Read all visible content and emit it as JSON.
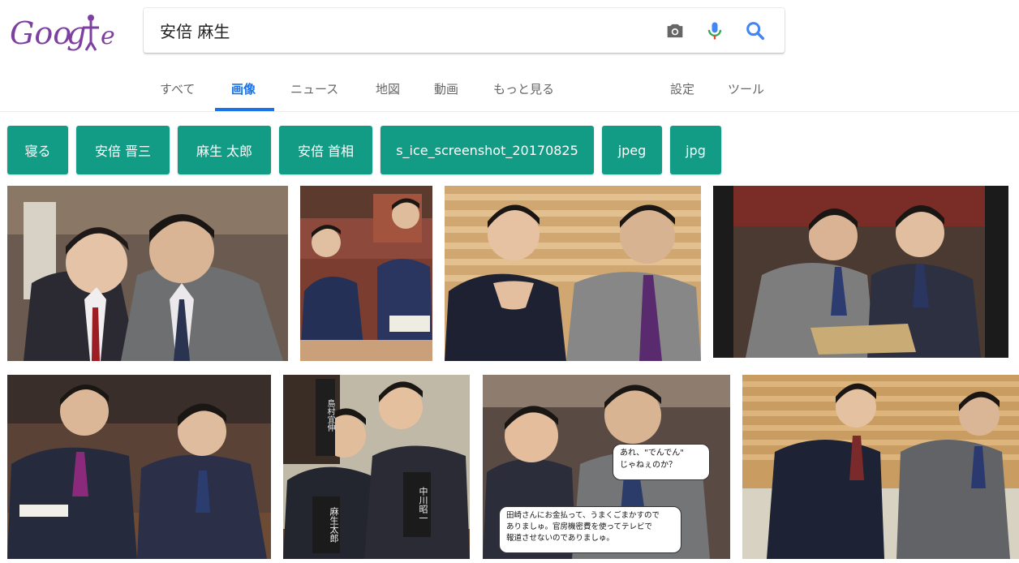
{
  "search": {
    "query": "安倍 麻生"
  },
  "tabs": [
    {
      "label": "すべて"
    },
    {
      "label": "画像"
    },
    {
      "label": "ニュース"
    },
    {
      "label": "地図"
    },
    {
      "label": "動画"
    },
    {
      "label": "もっと見る"
    },
    {
      "label": "設定"
    },
    {
      "label": "ツール"
    }
  ],
  "chips": [
    {
      "label": "寝る"
    },
    {
      "label": "安倍 晋三"
    },
    {
      "label": "麻生 太郎"
    },
    {
      "label": "安倍 首相"
    },
    {
      "label": "s_ice_screenshot_20170825"
    },
    {
      "label": "jpeg"
    },
    {
      "label": "jpg"
    }
  ],
  "images": {
    "img7_bubble_top": "あれ、\"でんでん\"\nじゃねぇのか？",
    "img7_bubble_bottom": "田崎さんにお金払って、うまくごまかすので\nありましゅ。官房機密費を使ってテレビで\n報道させないのでありましゅ。",
    "img6_placard_left": "麻生太郎",
    "img6_placard_right": "中川昭一",
    "img6_placard_top": "島村宜伸"
  },
  "colors": {
    "accent": "#1a73e8",
    "chip": "#129c85",
    "logo": "#7d3fa0"
  }
}
